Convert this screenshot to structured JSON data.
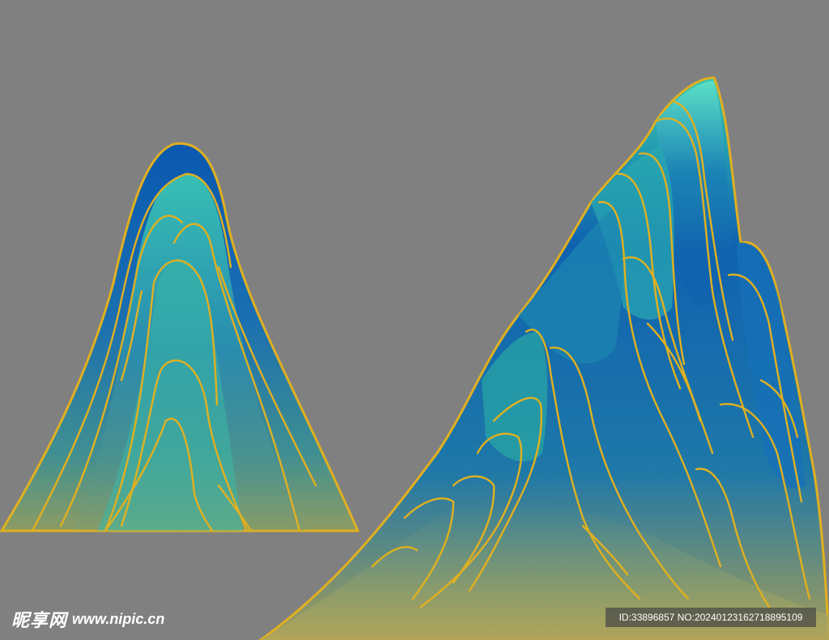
{
  "scene": {
    "background": "#808080",
    "mountain_colors": {
      "deep_blue": "#0e5fae",
      "teal": "#2fbfa8",
      "mint": "#5fe0c6",
      "olive_base": "#9a9b52",
      "gold_line": "#e0b020"
    },
    "objects": [
      "left-mountain",
      "right-mountain"
    ]
  },
  "watermark": {
    "site_cn": "昵享网",
    "site_url": "www.nipic.cn"
  },
  "id_bar": {
    "text": "ID:33896857 NO:20240123162718895109"
  }
}
